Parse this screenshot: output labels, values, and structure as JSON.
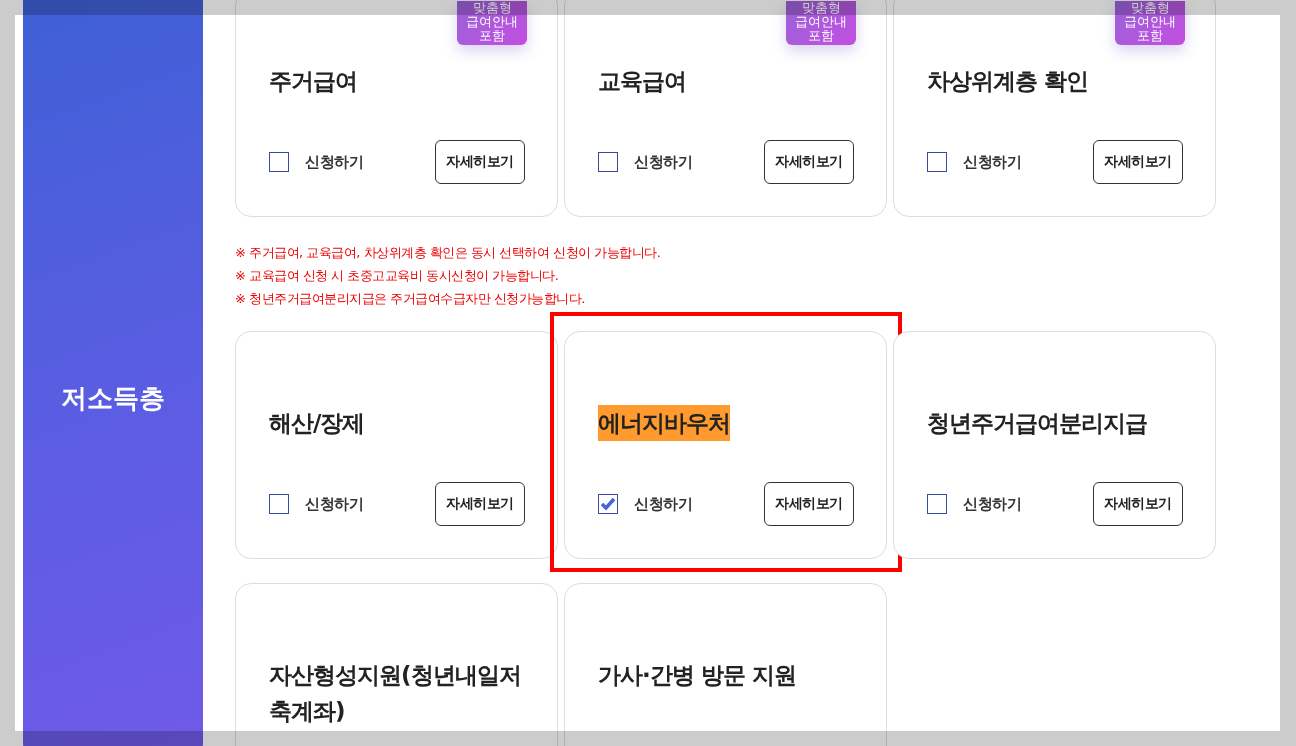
{
  "sidebar": {
    "title": "저소득층"
  },
  "rows": [
    {
      "cards": [
        {
          "title": "주거급여",
          "badge": "맞춤형 급여안내 포함",
          "checked": false,
          "marked": false,
          "highlighted": false,
          "check_label": "신청하기",
          "button": "자세히보기"
        },
        {
          "title": "교육급여",
          "badge": "맞춤형 급여안내 포함",
          "checked": false,
          "marked": false,
          "highlighted": false,
          "check_label": "신청하기",
          "button": "자세히보기"
        },
        {
          "title": "차상위계층 확인",
          "badge": "맞춤형 급여안내 포함",
          "checked": false,
          "marked": false,
          "highlighted": false,
          "check_label": "신청하기",
          "button": "자세히보기"
        }
      ],
      "notes": [
        "※ 주거급여, 교육급여, 차상위계층 확인은 동시 선택하여 신청이 가능합니다.",
        "※ 교육급여 신청 시 초중고교육비 동시신청이 가능합니다.",
        "※ 청년주거급여분리지급은 주거급여수급자만 신청가능합니다."
      ]
    },
    {
      "cards": [
        {
          "title": "해산/장제",
          "checked": false,
          "marked": false,
          "highlighted": false,
          "check_label": "신청하기",
          "button": "자세히보기"
        },
        {
          "title": "에너지바우처",
          "checked": true,
          "marked": true,
          "highlighted": true,
          "check_label": "신청하기",
          "button": "자세히보기"
        },
        {
          "title": "청년주거급여분리지급",
          "checked": false,
          "marked": false,
          "highlighted": false,
          "check_label": "신청하기",
          "button": "자세히보기"
        }
      ]
    },
    {
      "cards": [
        {
          "title": "자산형성지원(청년내일저축계좌)",
          "marked": false,
          "highlighted": false
        },
        {
          "title": "가사·간병 방문 지원",
          "marked": false,
          "highlighted": false
        }
      ]
    }
  ]
}
